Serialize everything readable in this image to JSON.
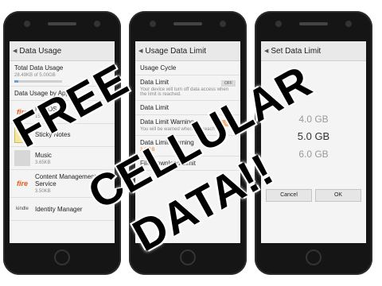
{
  "phones": {
    "left": {
      "title": "Data Usage",
      "total_label": "Total Data Usage",
      "total_value": "28.49KB of 5.00GB",
      "usage_section": "Data Usage by App",
      "apps": [
        {
          "name": "Fire OS",
          "size": "15.26KB",
          "icon": "fire-icon"
        },
        {
          "name": "Sticky Notes",
          "size": "",
          "icon": "sticky-note-icon"
        },
        {
          "name": "Music",
          "size": "3.65KB",
          "icon": "book-icon"
        },
        {
          "name": "Content Management Service",
          "size": "3.50KB",
          "icon": "fire-icon"
        },
        {
          "name": "Identity Manager",
          "size": "",
          "icon": "kindle-icon"
        }
      ],
      "icon_labels": {
        "fire": "fire",
        "kindle": "kindle"
      }
    },
    "middle": {
      "title": "Usage Data Limit",
      "cycle_label": "Usage Cycle",
      "limit_label": "Data Limit",
      "limit_desc": "Your device will turn off data access when the limit is reached.",
      "limit_toggle": "OFF",
      "data_limit_row": "Data Limit",
      "warning_label": "Data Limit Warning",
      "warning_desc": "You will be warned when you reach data",
      "warning_toggle": "ON",
      "warning_value_label": "Data Limit Warning",
      "warning_value": "2.0 GB",
      "file_download_label": "File Download Limit"
    },
    "right": {
      "title": "Set Data Limit",
      "options": [
        "4.0 GB",
        "5.0 GB",
        "6.0 GB"
      ],
      "selected_index": 1,
      "cancel_label": "Cancel",
      "ok_label": "OK"
    }
  },
  "overlay": {
    "line1": "FREE",
    "line2": "CELLULAR",
    "line3": "DATA!!"
  },
  "colors": {
    "accent_orange": "#e77b1c",
    "fire_red": "#e8581c",
    "usage_bar": "#6c9fd4"
  }
}
